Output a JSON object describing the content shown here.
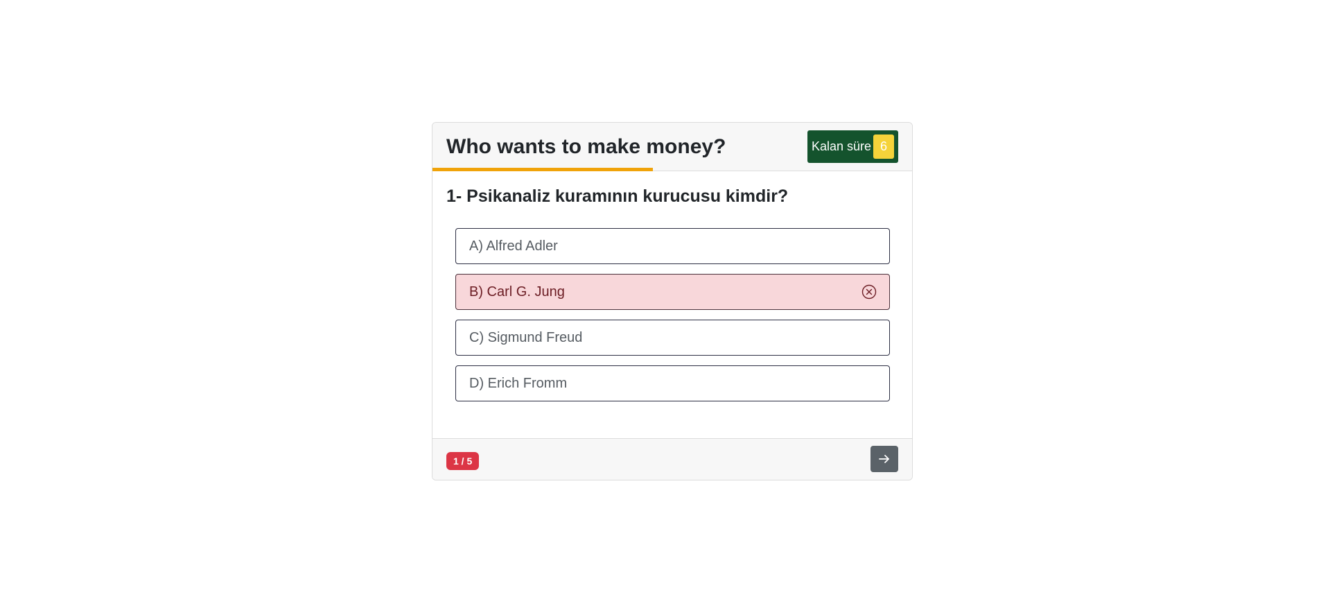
{
  "header": {
    "title": "Who wants to make money?",
    "timer_label": "Kalan süre",
    "timer_value": "6",
    "time_remaining_fraction": 0.46
  },
  "question": {
    "text": "1- Psikanaliz kuramının kurucusu kimdir?",
    "options": [
      {
        "label": "A) Alfred Adler",
        "state": "default"
      },
      {
        "label": "B) Carl G. Jung",
        "state": "incorrect",
        "icon": "x-circle-icon"
      },
      {
        "label": "C) Sigmund Freud",
        "state": "default"
      },
      {
        "label": "D) Erich Fromm",
        "state": "default"
      }
    ]
  },
  "footer": {
    "counter": "1 / 5",
    "next_icon": "arrow-right-icon"
  },
  "colors": {
    "timer_bg": "#14532d",
    "timer_value_bg": "#f5d33a",
    "progress": "#f0a30a",
    "incorrect_bg": "#f8d7da",
    "counter_bg": "#dc3545",
    "next_button_bg": "#5a6268"
  }
}
